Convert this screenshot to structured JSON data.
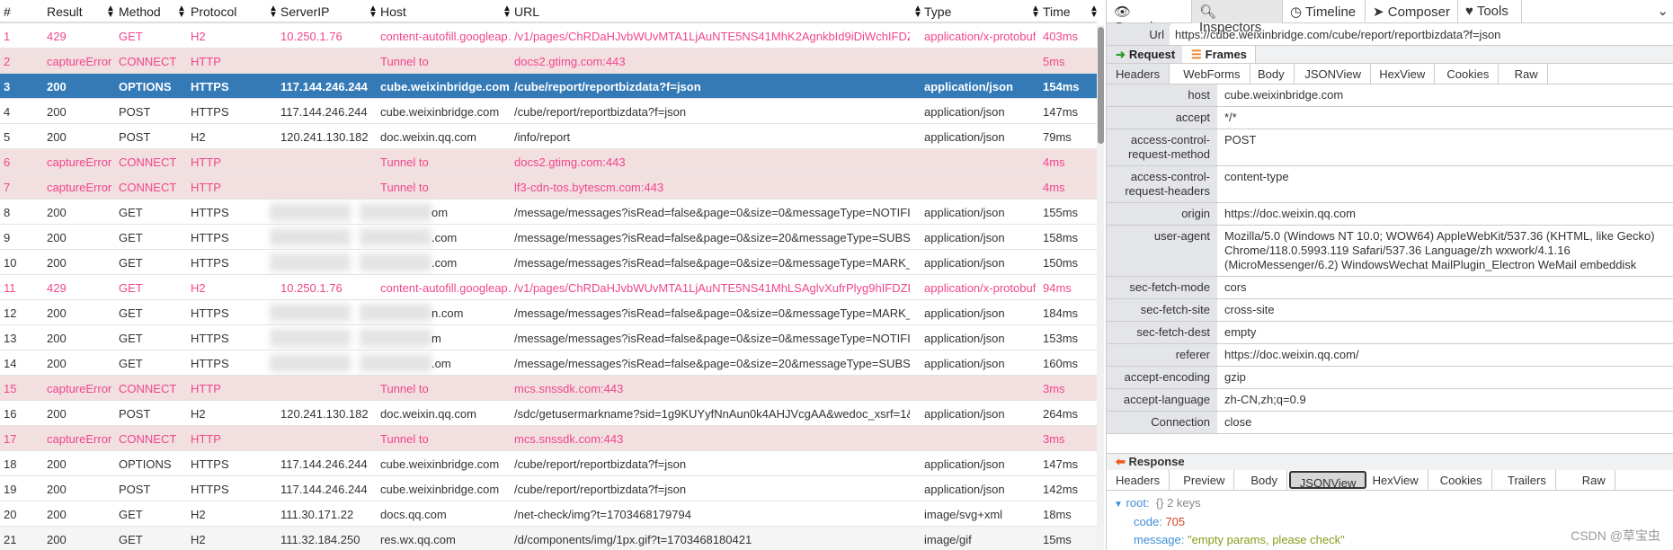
{
  "columns": [
    "#",
    "Result",
    "Method",
    "Protocol",
    "ServerIP",
    "Host",
    "URL",
    "Type",
    "Time"
  ],
  "rows": [
    {
      "n": "1",
      "result": "429",
      "method": "GET",
      "protocol": "H2",
      "ip": "10.250.1.76",
      "host": "content-autofill.googleap…",
      "url": "/v1/pages/ChRDaHJvbWUvMTA1LjAuNTE5NS41MhK2AgnkbId9iDiWchIFDZFhl…",
      "type": "application/x-protobuf",
      "time": "403ms",
      "state": "err"
    },
    {
      "n": "2",
      "result": "captureError",
      "method": "CONNECT",
      "protocol": "HTTP",
      "ip": "",
      "host": "Tunnel to",
      "url": "docs2.gtimg.com:443",
      "type": "",
      "time": "5ms",
      "state": "tun"
    },
    {
      "n": "3",
      "result": "200",
      "method": "OPTIONS",
      "protocol": "HTTPS",
      "ip": "117.144.246.244",
      "host": "cube.weixinbridge.com",
      "url": "/cube/report/reportbizdata?f=json",
      "type": "application/json",
      "time": "154ms",
      "state": "sel"
    },
    {
      "n": "4",
      "result": "200",
      "method": "POST",
      "protocol": "HTTPS",
      "ip": "117.144.246.244",
      "host": "cube.weixinbridge.com",
      "url": "/cube/report/reportbizdata?f=json",
      "type": "application/json",
      "time": "147ms",
      "state": ""
    },
    {
      "n": "5",
      "result": "200",
      "method": "POST",
      "protocol": "H2",
      "ip": "120.241.130.182",
      "host": "doc.weixin.qq.com",
      "url": "/info/report",
      "type": "application/json",
      "time": "79ms",
      "state": ""
    },
    {
      "n": "6",
      "result": "captureError",
      "method": "CONNECT",
      "protocol": "HTTP",
      "ip": "",
      "host": "Tunnel to",
      "url": "docs2.gtimg.com:443",
      "type": "",
      "time": "4ms",
      "state": "tun"
    },
    {
      "n": "7",
      "result": "captureError",
      "method": "CONNECT",
      "protocol": "HTTP",
      "ip": "",
      "host": "Tunnel to",
      "url": "lf3-cdn-tos.bytescm.com:443",
      "type": "",
      "time": "4ms",
      "state": "tun"
    },
    {
      "n": "8",
      "result": "200",
      "method": "GET",
      "protocol": "HTTPS",
      "ip": "",
      "host": "om",
      "url": "/message/messages?isRead=false&page=0&size=0&messageType=NOTIFICATI…",
      "type": "application/json",
      "time": "155ms",
      "state": "",
      "blur": true
    },
    {
      "n": "9",
      "result": "200",
      "method": "GET",
      "protocol": "HTTPS",
      "ip": "",
      "host": ".com",
      "url": "/message/messages?isRead=false&page=0&size=20&messageType=SUBSCRIBE",
      "type": "application/json",
      "time": "158ms",
      "state": "",
      "blur": true
    },
    {
      "n": "10",
      "result": "200",
      "method": "GET",
      "protocol": "HTTPS",
      "ip": "",
      "host": ".com",
      "url": "/message/messages?isRead=false&page=0&size=0&messageType=MARK_UP",
      "type": "application/json",
      "time": "150ms",
      "state": "",
      "blur": true
    },
    {
      "n": "11",
      "result": "429",
      "method": "GET",
      "protocol": "H2",
      "ip": "10.250.1.76",
      "host": "content-autofill.googleap…",
      "url": "/v1/pages/ChRDaHJvbWUvMTA1LjAuNTE5NS41MhLSAglvXufrPlyg9hIFDZFhlU…",
      "type": "application/x-protobuf",
      "time": "94ms",
      "state": "err"
    },
    {
      "n": "12",
      "result": "200",
      "method": "GET",
      "protocol": "HTTPS",
      "ip": "",
      "host": "n.com",
      "url": "/message/messages?isRead=false&page=0&size=0&messageType=MARK_UP&…",
      "type": "application/json",
      "time": "184ms",
      "state": "",
      "blur": true
    },
    {
      "n": "13",
      "result": "200",
      "method": "GET",
      "protocol": "HTTPS",
      "ip": "",
      "host": "m",
      "url": "/message/messages?isRead=false&page=0&size=0&messageType=NOTIFICATI…",
      "type": "application/json",
      "time": "153ms",
      "state": "",
      "blur": true
    },
    {
      "n": "14",
      "result": "200",
      "method": "GET",
      "protocol": "HTTPS",
      "ip": "",
      "host": ".om",
      "url": "/message/messages?isRead=false&page=0&size=20&messageType=SUBSCRI…",
      "type": "application/json",
      "time": "160ms",
      "state": "",
      "blur": true
    },
    {
      "n": "15",
      "result": "captureError",
      "method": "CONNECT",
      "protocol": "HTTP",
      "ip": "",
      "host": "Tunnel to",
      "url": "mcs.snssdk.com:443",
      "type": "",
      "time": "3ms",
      "state": "tun"
    },
    {
      "n": "16",
      "result": "200",
      "method": "POST",
      "protocol": "H2",
      "ip": "120.241.130.182",
      "host": "doc.weixin.qq.com",
      "url": "/sdc/getusermarkname?sid=1g9KUYyfNnAun0k4AHJVcgAA&wedoc_xsrf=1&xsrf…",
      "type": "application/json",
      "time": "264ms",
      "state": ""
    },
    {
      "n": "17",
      "result": "captureError",
      "method": "CONNECT",
      "protocol": "HTTP",
      "ip": "",
      "host": "Tunnel to",
      "url": "mcs.snssdk.com:443",
      "type": "",
      "time": "3ms",
      "state": "tun"
    },
    {
      "n": "18",
      "result": "200",
      "method": "OPTIONS",
      "protocol": "HTTPS",
      "ip": "117.144.246.244",
      "host": "cube.weixinbridge.com",
      "url": "/cube/report/reportbizdata?f=json",
      "type": "application/json",
      "time": "147ms",
      "state": ""
    },
    {
      "n": "19",
      "result": "200",
      "method": "POST",
      "protocol": "HTTPS",
      "ip": "117.144.246.244",
      "host": "cube.weixinbridge.com",
      "url": "/cube/report/reportbizdata?f=json",
      "type": "application/json",
      "time": "142ms",
      "state": ""
    },
    {
      "n": "20",
      "result": "200",
      "method": "GET",
      "protocol": "H2",
      "ip": "111.30.171.22",
      "host": "docs.qq.com",
      "url": "/net-check/img?t=1703468179794",
      "type": "image/svg+xml",
      "time": "18ms",
      "state": ""
    },
    {
      "n": "21",
      "result": "200",
      "method": "GET",
      "protocol": "H2",
      "ip": "111.32.184.250",
      "host": "res.wx.qq.com",
      "url": "/d/components/img/1px.gif?t=1703468180421",
      "type": "image/gif",
      "time": "15ms",
      "state": "hov"
    }
  ],
  "tabs": {
    "overview": "Overview",
    "inspectors": "Inspectors",
    "timeline": "Timeline",
    "composer": "Composer",
    "tools": "Tools"
  },
  "url": {
    "label": "Url",
    "value": "https://cube.weixinbridge.com/cube/report/reportbizdata?f=json"
  },
  "request": {
    "label": "Request",
    "frames": "Frames",
    "subtabs": [
      "Headers",
      "WebForms",
      "Body",
      "JSONView",
      "HexView",
      "Cookies",
      "Raw"
    ],
    "headers": [
      {
        "k": "host",
        "v": "cube.weixinbridge.com"
      },
      {
        "k": "accept",
        "v": "*/*"
      },
      {
        "k": "access-control-request-method",
        "v": "POST"
      },
      {
        "k": "access-control-request-headers",
        "v": "content-type"
      },
      {
        "k": "origin",
        "v": "https://doc.weixin.qq.com"
      },
      {
        "k": "user-agent",
        "v": "Mozilla/5.0 (Windows NT 10.0; WOW64) AppleWebKit/537.36 (KHTML, like Gecko) Chrome/118.0.5993.119 Safari/537.36 Language/zh wxwork/4.1.16 (MicroMessenger/6.2) WindowsWechat  MailPlugin_Electron WeMail embeddisk"
      },
      {
        "k": "sec-fetch-mode",
        "v": "cors"
      },
      {
        "k": "sec-fetch-site",
        "v": "cross-site"
      },
      {
        "k": "sec-fetch-dest",
        "v": "empty"
      },
      {
        "k": "referer",
        "v": "https://doc.weixin.qq.com/"
      },
      {
        "k": "accept-encoding",
        "v": "gzip"
      },
      {
        "k": "accept-language",
        "v": "zh-CN,zh;q=0.9"
      },
      {
        "k": "Connection",
        "v": "close"
      }
    ]
  },
  "response": {
    "label": "Response",
    "subtabs": [
      "Headers",
      "Preview",
      "Body",
      "JSONView",
      "HexView",
      "Cookies",
      "Trailers",
      "Raw"
    ],
    "json": {
      "root": "root:",
      "braces": "{}",
      "keys": "2 keys",
      "code_key": "code:",
      "code_val": "705",
      "message_key": "message:",
      "message_val": "\"empty params, please check\""
    }
  },
  "watermark": "CSDN @草宝虫",
  "colors": {
    "selected": "#337ab7",
    "error_text": "#f0468c",
    "tunnel_bg": "#f2dfe0"
  }
}
